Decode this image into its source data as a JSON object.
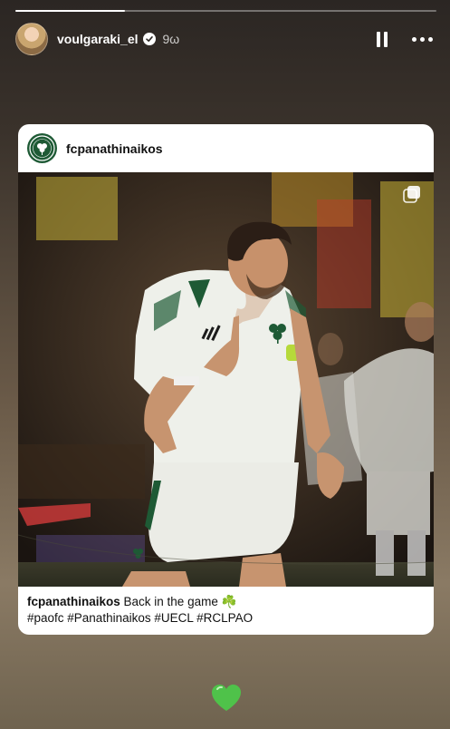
{
  "story": {
    "progress_fraction": 0.26,
    "username": "voulgaraki_el",
    "timestamp": "9ω",
    "verified": true
  },
  "post": {
    "username": "fcpanathinaikos",
    "caption": {
      "username": "fcpanathinaikos",
      "text": " Back in the game ☘️",
      "hashtags": "#paofc #Panathinaikos #UECL #RCLPAO"
    },
    "is_carousel": true
  },
  "reaction": {
    "icon": "green-heart-icon",
    "color": "#4fc24a"
  },
  "colors": {
    "panathinaikos_green": "#1e5a35",
    "story_text": "#ffffff"
  }
}
